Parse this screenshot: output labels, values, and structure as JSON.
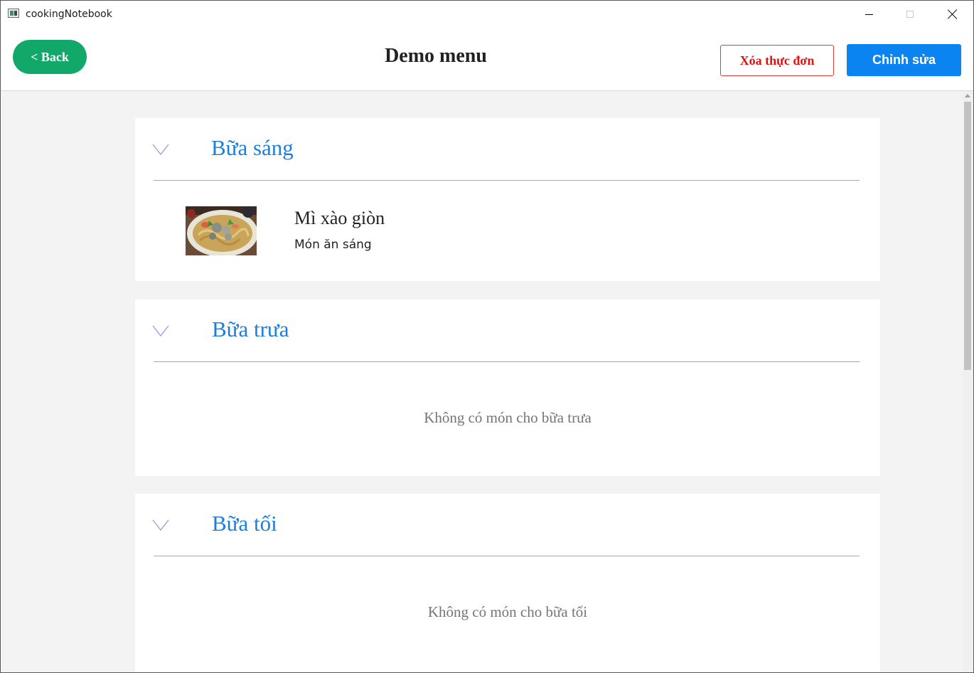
{
  "window": {
    "title": "cookingNotebook",
    "controls": [
      "minimize-icon",
      "maximize-icon",
      "close-icon"
    ]
  },
  "header": {
    "back_label": "< Back",
    "title": "Demo menu",
    "delete_label": "Xóa thực đơn",
    "edit_label": "Chỉnh sửa"
  },
  "sections": [
    {
      "title": "Bữa sáng",
      "dishes": [
        {
          "name": "Mì xào giòn",
          "type": "Món ăn sáng",
          "image": "fried-noodles-photo"
        }
      ]
    },
    {
      "title": "Bữa trưa",
      "empty_message": "Không có món cho bữa trưa"
    },
    {
      "title": "Bữa tối",
      "empty_message": "Không có món cho bữa tối"
    }
  ],
  "colors": {
    "back_button": "#12a86a",
    "edit_button": "#0b84f1",
    "delete_button_text": "#e01010",
    "section_title": "#1a7fe0",
    "content_background": "#f3f3f3"
  }
}
